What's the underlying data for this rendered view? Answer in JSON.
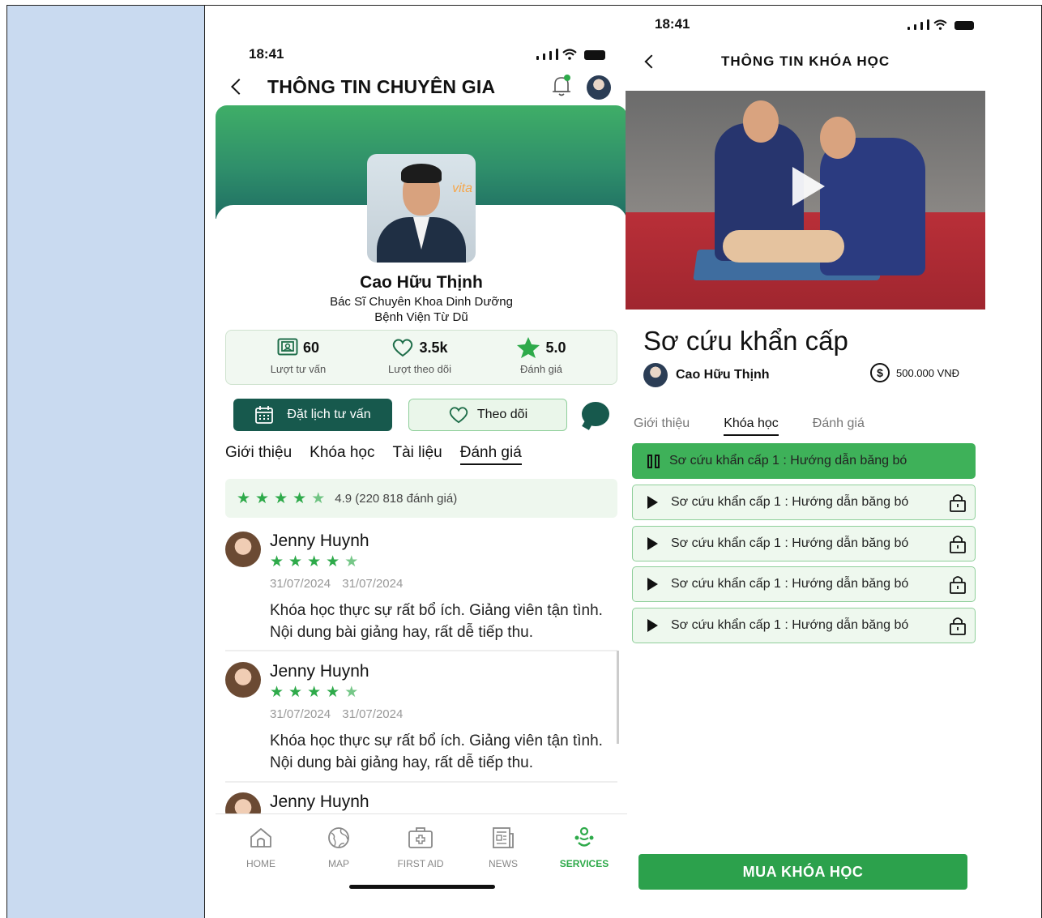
{
  "expert_screen": {
    "status_time": "18:41",
    "title": "THÔNG TIN CHUYÊN GIA",
    "brand_on_photo": "vita",
    "expert": {
      "name": "Cao Hữu Thịnh",
      "specialty": "Bác Sĩ Chuyên Khoa Dinh Dưỡng",
      "hospital": "Bệnh Viện Từ Dũ"
    },
    "stats": [
      {
        "value": "60",
        "label": "Lượt tư vấn",
        "icon": "consult-icon"
      },
      {
        "value": "3.5k",
        "label": "Lượt theo dõi",
        "icon": "heart-icon"
      },
      {
        "value": "5.0",
        "label": "Đánh giá",
        "icon": "star-icon"
      }
    ],
    "book_button": "Đặt lịch tư vấn",
    "follow_button": "Theo dõi",
    "tabs": [
      "Giới thiệu",
      "Khóa học",
      "Tài liệu",
      "Đánh giá"
    ],
    "active_tab": "Đánh giá",
    "rating_summary": "4.9 (220 818 đánh giá)",
    "rating_stars": 4.5,
    "reviews": [
      {
        "name": "Jenny Huynh",
        "stars": 4.5,
        "dates": "31/07/2024 31/07/2024",
        "text": "Khóa học thực sự rất bổ ích. Giảng viên tận tình. Nội dung bài giảng hay, rất dễ tiếp thu."
      },
      {
        "name": "Jenny Huynh",
        "stars": 4.5,
        "dates": "31/07/2024 31/07/2024",
        "text": "Khóa học thực sự rất bổ ích. Giảng viên tận tình. Nội dung bài giảng hay, rất dễ tiếp thu."
      },
      {
        "name": "Jenny Huynh"
      }
    ],
    "nav": [
      {
        "label": "HOME",
        "icon": "home-icon"
      },
      {
        "label": "MAP",
        "icon": "globe-icon"
      },
      {
        "label": "FIRST AID",
        "icon": "first-aid-kit-icon"
      },
      {
        "label": "NEWS",
        "icon": "newspaper-icon"
      },
      {
        "label": "SERVICES",
        "icon": "services-icon",
        "active": true
      }
    ],
    "accent_color": "#2eaa4a",
    "dark_green": "#17594d"
  },
  "course_screen": {
    "status_time": "18:41",
    "title": "THÔNG TIN KHÓA HỌC",
    "course_title": "Sơ cứu khẩn cấp",
    "instructor": "Cao Hữu Thịnh",
    "price": "500.000 VNĐ",
    "tabs": [
      "Giới thiệu",
      "Khóa học",
      "Đánh giá"
    ],
    "active_tab": "Khóa học",
    "lessons": [
      {
        "title": "Sơ cứu khẩn cấp 1 : Hướng dẫn băng bó",
        "state": "playing"
      },
      {
        "title": "Sơ cứu khẩn cấp 1 : Hướng dẫn băng bó",
        "state": "locked"
      },
      {
        "title": "Sơ cứu khẩn cấp 1 : Hướng dẫn băng bó",
        "state": "locked"
      },
      {
        "title": "Sơ cứu khẩn cấp 1 : Hướng dẫn băng bó",
        "state": "locked"
      },
      {
        "title": "Sơ cứu khẩn cấp 1 : Hướng dẫn băng bó",
        "state": "locked"
      }
    ],
    "buy_button": "MUA KHÓA HỌC",
    "accent_color": "#2ca14c"
  },
  "sidebar_color": "#c9daf0"
}
